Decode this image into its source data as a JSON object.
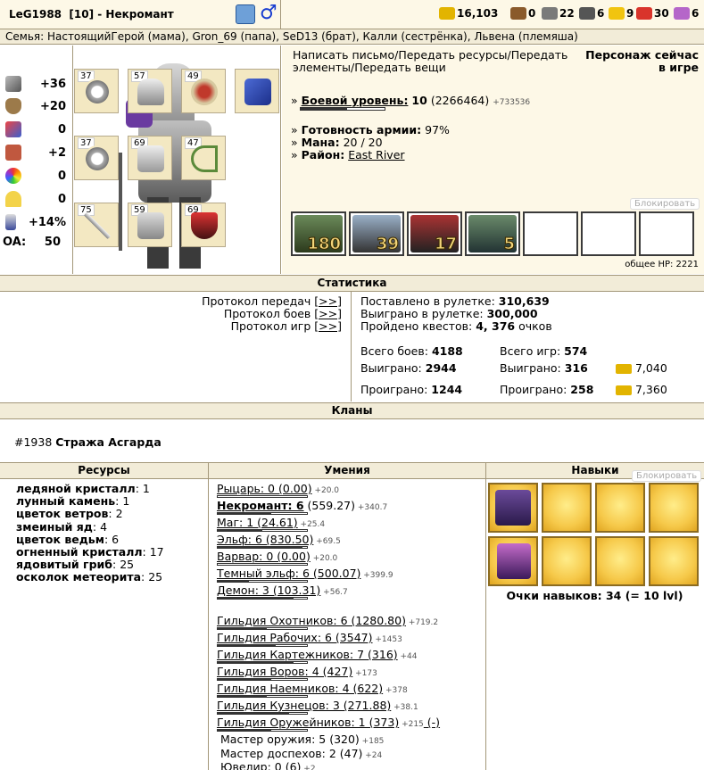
{
  "header": {
    "name": "LeG1988",
    "level": "[10]",
    "class": "- Некромант",
    "resources": [
      {
        "icon": "gold-icon",
        "value": "16,103",
        "color": "#e2b400"
      },
      {
        "icon": "wood-icon",
        "value": "0",
        "color": "#8a5a2b"
      },
      {
        "icon": "ore-icon",
        "value": "22",
        "color": "#7a7a7a"
      },
      {
        "icon": "mercury-icon",
        "value": "6",
        "color": "#555555"
      },
      {
        "icon": "sulfur-icon",
        "value": "9",
        "color": "#f1c40f"
      },
      {
        "icon": "crystal-icon",
        "value": "30",
        "color": "#d9342b"
      },
      {
        "icon": "gems-icon",
        "value": "6",
        "color": "#b566c9"
      }
    ]
  },
  "family": "Семья: НастоящийГерой (мама), Gron_69 (папа), SeD13 (брат), Калли (сестрёнка), Львена (племяша)",
  "stats": [
    {
      "icon": "attack-icon",
      "value": "+36"
    },
    {
      "icon": "defense-icon",
      "value": "+20"
    },
    {
      "icon": "spellpower-icon",
      "value": "0"
    },
    {
      "icon": "knowledge-icon",
      "value": "+2"
    },
    {
      "icon": "luck-icon",
      "value": "0"
    },
    {
      "icon": "morale-icon",
      "value": "0"
    },
    {
      "icon": "initiative-icon",
      "value": "+14%"
    }
  ],
  "oa": {
    "label": "OA:",
    "value": "50"
  },
  "equipment": [
    {
      "slot": "ring-1",
      "lvl": "37"
    },
    {
      "slot": "helmet",
      "lvl": "57"
    },
    {
      "slot": "amulet",
      "lvl": "49"
    },
    {
      "slot": "spellbook",
      "lvl": ""
    },
    {
      "slot": "ring-2",
      "lvl": "37"
    },
    {
      "slot": "armor",
      "lvl": "69"
    },
    {
      "slot": "bow",
      "lvl": "47"
    },
    {
      "slot": "weapon",
      "lvl": "75"
    },
    {
      "slot": "boots",
      "lvl": "59"
    },
    {
      "slot": "shield",
      "lvl": "69"
    }
  ],
  "info": {
    "actions": "Написать письмо/Передать ресурсы/Передать элементы/Передать вещи",
    "online": "Персонаж сейчас в игре",
    "combat_label": "Боевой уровень:",
    "combat_value": "10",
    "combat_exp": "(2266464)",
    "combat_gain": "+733536",
    "combat_progress": 0.55,
    "army_label": "Готовность армии:",
    "army_value": "97%",
    "mana_label": "Мана:",
    "mana_value": "20 / 20",
    "district_label": "Район:",
    "district_value": "East River",
    "block": "Блокировать",
    "army": [
      "180",
      "39",
      "17",
      "5",
      "",
      "",
      ""
    ],
    "hp": "общее HP: 2221"
  },
  "statistics": {
    "title": "Статистика",
    "links": [
      {
        "label": "Протокол передач",
        "btn": "[>>]"
      },
      {
        "label": "Протокол боев",
        "btn": "[>>]"
      },
      {
        "label": "Протокол игр",
        "btn": "[>>]"
      }
    ],
    "roulette_bet_label": "Поставлено в рулетке:",
    "roulette_bet": "310,639",
    "roulette_won_label": "Выиграно в рулетке:",
    "roulette_won": "300,000",
    "quests_label": "Пройдено квестов:",
    "quests": "4, 376",
    "quests_suffix": "очков",
    "battles_total_label": "Всего боев:",
    "battles_total": "4188",
    "battles_won_label": "Выиграно:",
    "battles_won": "2944",
    "battles_lost_label": "Проиграно:",
    "battles_lost": "1244",
    "games_total_label": "Всего игр:",
    "games_total": "574",
    "games_won_label": "Выиграно:",
    "games_won": "316",
    "games_lost_label": "Проиграно:",
    "games_lost": "258",
    "gold_won": "7,040",
    "gold_lost": "7,360"
  },
  "clans": {
    "title": "Кланы",
    "id": "#1938",
    "name": "Стража Асгарда"
  },
  "resources": {
    "title": "Ресурсы",
    "items": [
      {
        "name": "ледяной кристалл",
        "value": ": 1"
      },
      {
        "name": "лунный камень",
        "value": ": 1"
      },
      {
        "name": "цветок ветров",
        "value": ": 2"
      },
      {
        "name": "змеиный яд",
        "value": ": 4"
      },
      {
        "name": "цветок ведьм",
        "value": ": 6"
      },
      {
        "name": "огненный кристалл",
        "value": ": 17"
      },
      {
        "name": "ядовитый гриб",
        "value": ": 25"
      },
      {
        "name": "осколок метеорита",
        "value": ": 25"
      }
    ]
  },
  "skills": {
    "title": "Умения",
    "items": [
      {
        "name": "Рыцарь: 0 (0.00)",
        "gain": "+20.0",
        "progress": 0.0,
        "bold": false
      },
      {
        "name": "Некромант: 6",
        "rest": " (559.27)",
        "gain": "+340.7",
        "progress": 0.6,
        "bold": true
      },
      {
        "name": "Маг: 1 (24.61)",
        "gain": "+25.4",
        "progress": 0.5
      },
      {
        "name": "Эльф: 6 (830.50)",
        "gain": "+69.5",
        "progress": 0.95
      },
      {
        "name": "Варвар: 0 (0.00)",
        "gain": "+20.0",
        "progress": 0.0
      },
      {
        "name": "Темный эльф: 6 (500.07)",
        "gain": "+399.9",
        "progress": 0.35
      },
      {
        "name": "Демон: 3 (103.31)",
        "gain": "+56.7",
        "progress": 0.85
      },
      {
        "name": "Гильдия Охотников: 6 (1280.80)",
        "gain": "+719.2",
        "progress": 0.55
      },
      {
        "name": "Гильдия Рабочих: 6 (3547)",
        "gain": "+1453",
        "progress": 0.65
      },
      {
        "name": "Гильдия Картежников: 7 (316)",
        "gain": "+44",
        "progress": 0.85
      },
      {
        "name": "Гильдия Воров: 4 (427)",
        "gain": "+173",
        "progress": 0.6
      },
      {
        "name": "Гильдия Наемников: 4 (622)",
        "gain": "+378",
        "progress": 0.55
      },
      {
        "name": "Гильдия Кузнецов: 3 (271.88)",
        "gain": "+38.1",
        "progress": 0.8
      },
      {
        "name": "Гильдия Оружейников: 1 (373)",
        "gain": "+215",
        "progress": 0.6,
        "extra": "(-)"
      },
      {
        "name": "Мастер оружия: 5 (320)",
        "gain": "+185",
        "plain": true
      },
      {
        "name": "Мастер доспехов: 2 (47)",
        "gain": "+24",
        "plain": true
      },
      {
        "name": "Ювелир: 0 (6)",
        "gain": "+2",
        "plain": true
      }
    ]
  },
  "perks": {
    "title": "Навыки",
    "block": "Блокировать",
    "points": "Очки навыков: 34 (= 10 lvl)"
  }
}
